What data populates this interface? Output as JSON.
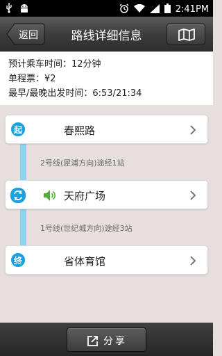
{
  "status_bar": {
    "time": "2:41PM",
    "icons": [
      "usb-icon",
      "android-icon",
      "alarm-icon",
      "wifi-icon",
      "signal-icon",
      "battery-icon"
    ]
  },
  "header": {
    "back_label": "返回",
    "title": "路线详细信息",
    "map_icon": "map-icon"
  },
  "info": {
    "ride_time": "预计乘车时间：12分钟",
    "fare": "单程票：¥2",
    "first_last": "最早/最晚出发时间：6:53/21:34"
  },
  "route": {
    "stops": [
      {
        "badge": "起",
        "name": "春熙路"
      },
      {
        "badge_icon": "transfer-icon",
        "name": "天府广场",
        "audio_icon": "speaker-icon"
      },
      {
        "badge": "终",
        "name": "省体育馆"
      }
    ],
    "segments": [
      "2号线(犀浦方向)途经1站",
      "1号线(世纪城方向)途经3站"
    ]
  },
  "footer": {
    "share_label": "分享",
    "share_icon": "share-icon"
  },
  "colors": {
    "accent": "#1ba1dd",
    "route_line": "#8fd1ef",
    "speaker_green": "#4caf2f",
    "background": "#e6dfde"
  }
}
